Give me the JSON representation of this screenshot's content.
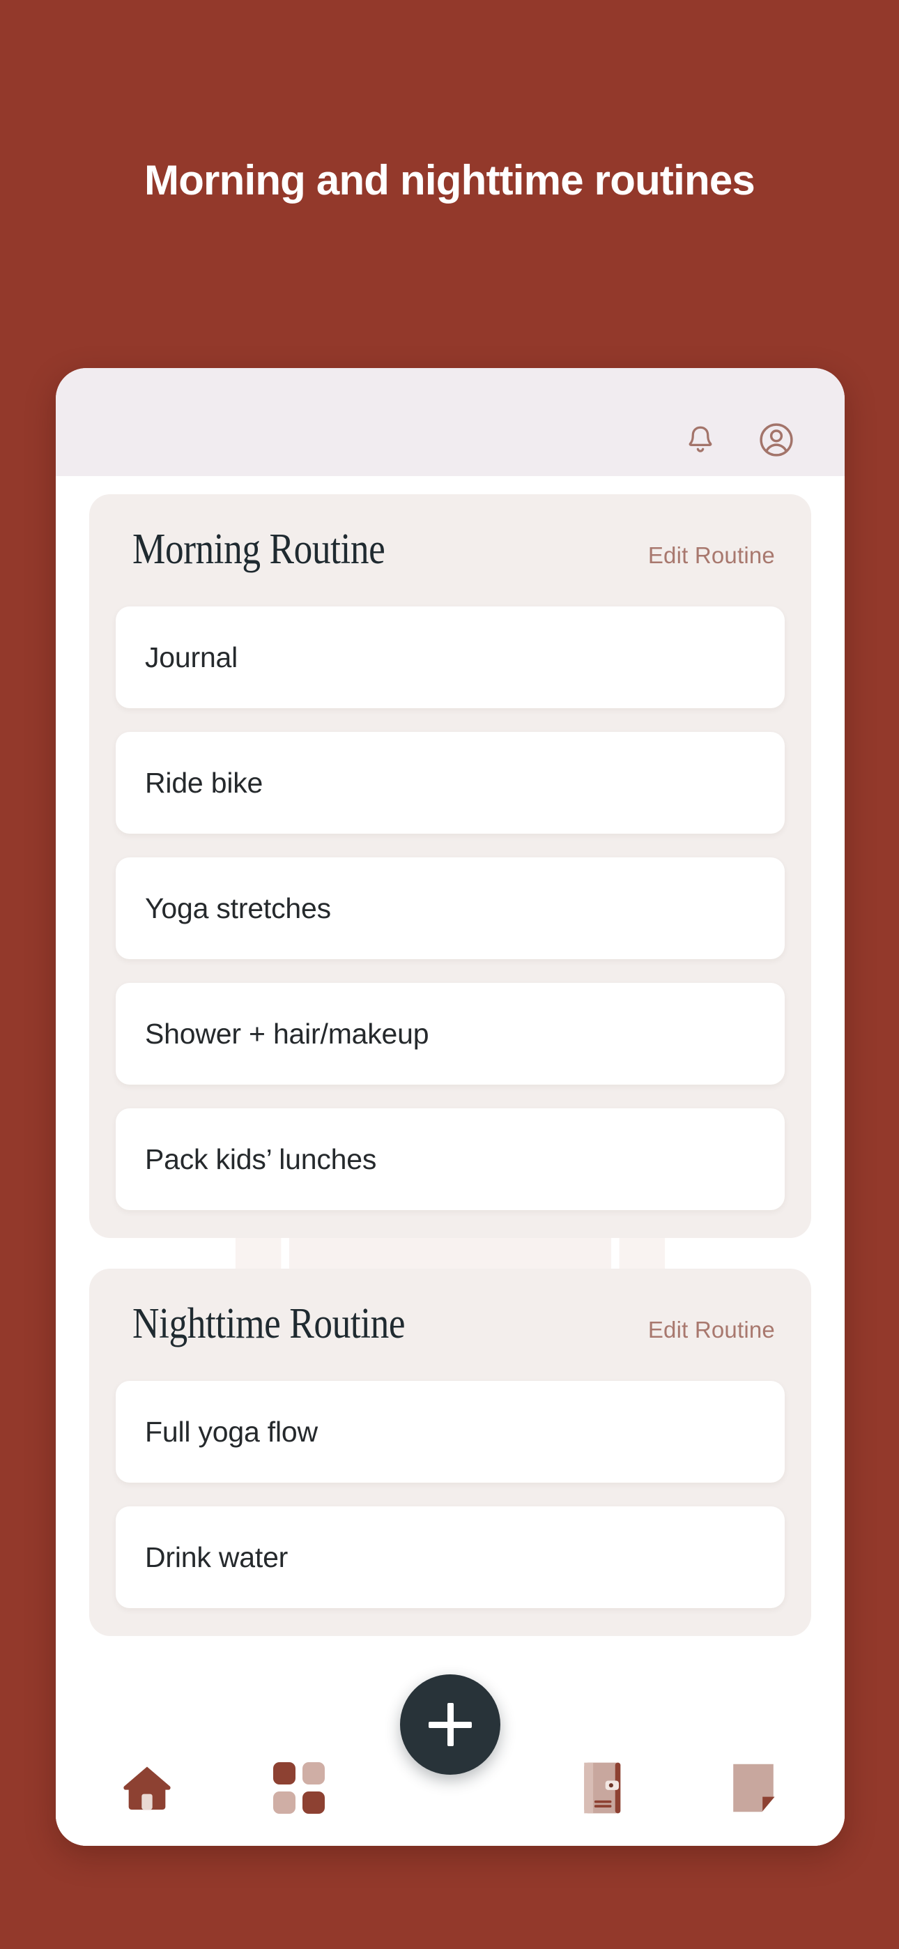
{
  "page": {
    "headline": "Morning and nighttime routines",
    "background_color": "#93392b"
  },
  "app": {
    "appbar": {
      "notification_icon": "bell-icon",
      "profile_icon": "user-circle-icon",
      "icon_color": "#a3746a",
      "background_color": "#f1ecf0"
    },
    "sections": [
      {
        "title": "Morning Routine",
        "edit_label": "Edit Routine",
        "tasks": [
          {
            "label": "Journal"
          },
          {
            "label": "Ride bike"
          },
          {
            "label": "Yoga stretches"
          },
          {
            "label": "Shower + hair/makeup"
          },
          {
            "label": "Pack kids’ lunches"
          }
        ]
      },
      {
        "title": "Nighttime Routine",
        "edit_label": "Edit Routine",
        "tasks": [
          {
            "label": "Full yoga flow"
          },
          {
            "label": "Drink water"
          }
        ]
      }
    ],
    "fab": {
      "icon": "plus-icon",
      "color": "#283339"
    },
    "navbar": {
      "items": [
        {
          "icon": "home-icon",
          "state": "active"
        },
        {
          "icon": "grid-icon",
          "state": "inactive"
        },
        {
          "icon": "journal-icon",
          "state": "inactive"
        },
        {
          "icon": "note-page-icon",
          "state": "inactive"
        }
      ],
      "colors": {
        "accent_dark": "#8d4132",
        "accent_light": "#cfaea5",
        "accent_mid": "#c8a79e"
      }
    }
  }
}
